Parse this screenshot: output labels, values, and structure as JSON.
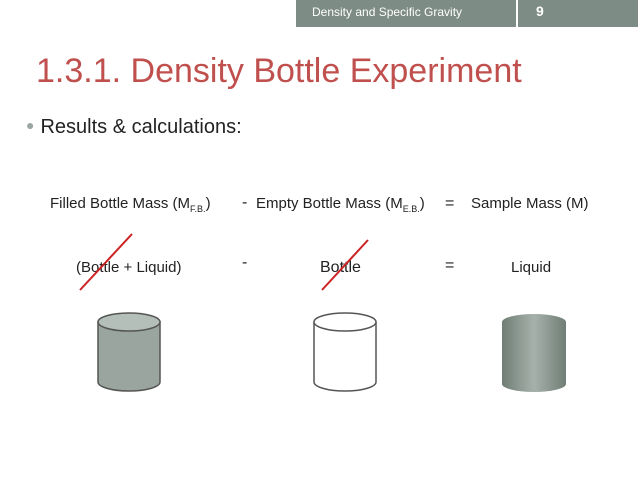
{
  "header": {
    "title": "Density and Specific Gravity",
    "slide_number": "9"
  },
  "slide": {
    "title": "1.3.1. Density Bottle Experiment",
    "bullet": "Results & calculations:"
  },
  "equation_row": {
    "filled_pre": "Filled Bottle Mass (M",
    "filled_sub": "F.B.",
    "filled_post": ")",
    "minus": "-",
    "empty_pre": "Empty Bottle Mass (M",
    "empty_sub": "E.B.",
    "empty_post": ")",
    "equals": "=",
    "sample": "Sample Mass (M)"
  },
  "word_row": {
    "filled": "(Bottle + Liquid)",
    "minus": "-",
    "empty": "Bottle",
    "equals": "=",
    "sample": "Liquid"
  },
  "colors": {
    "header_bar": "#7d8c84",
    "title": "#c0504d",
    "cross_line": "#cc2222",
    "cylinder_fill": "#9aa59f",
    "cylinder_top": "#b5bfb9",
    "cylinder_stroke": "#555555"
  }
}
